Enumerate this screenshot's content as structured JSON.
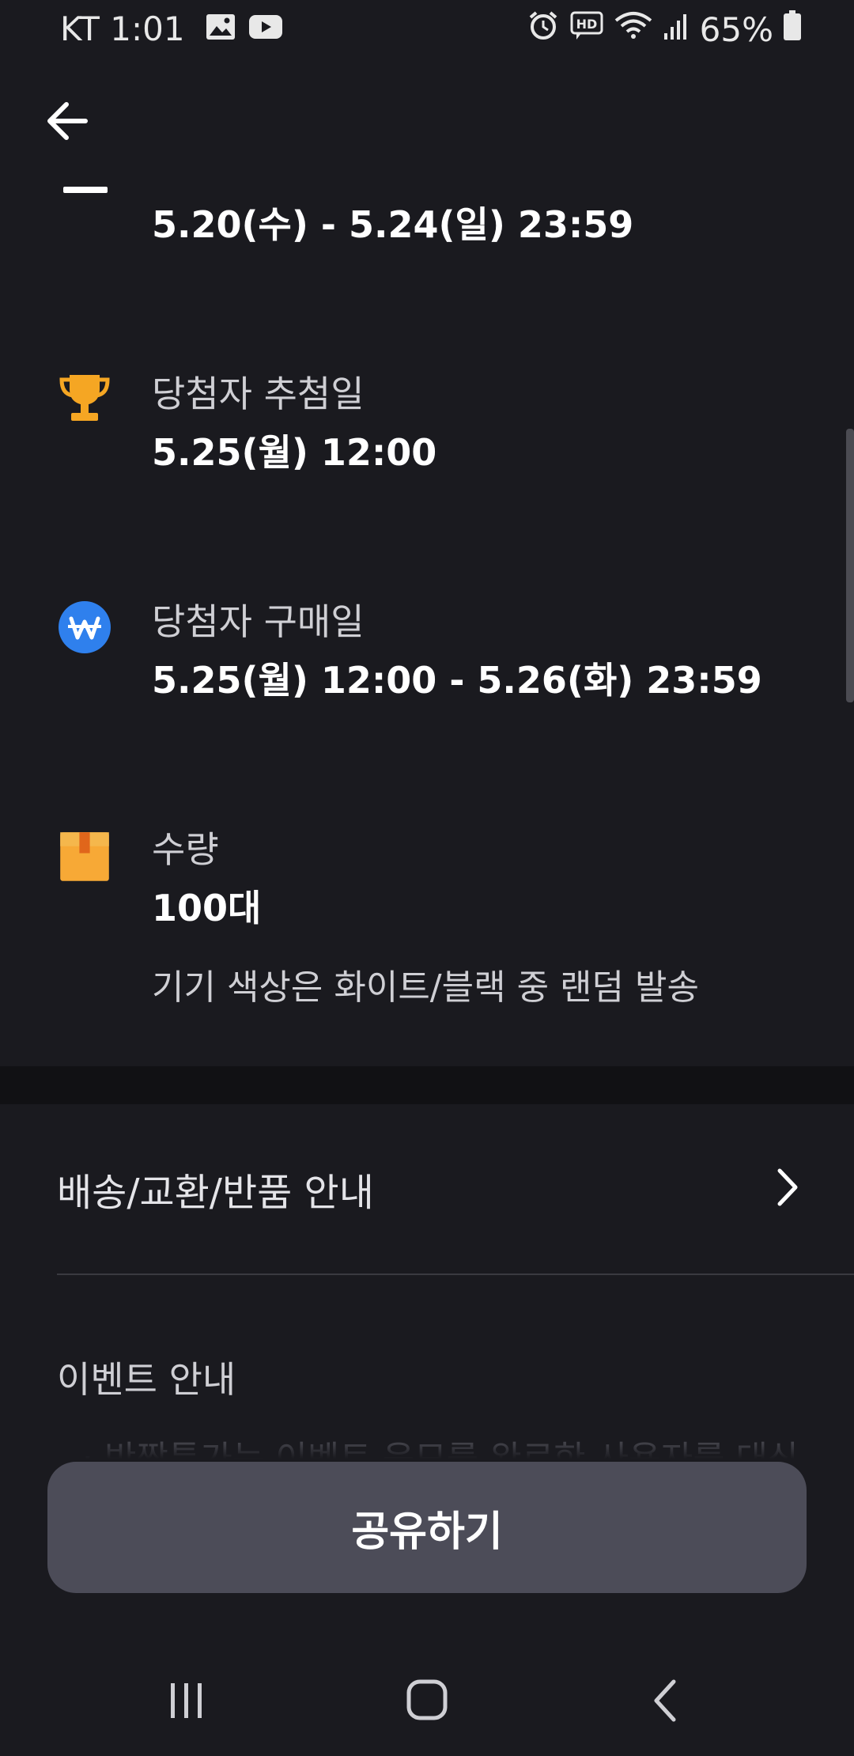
{
  "status_bar": {
    "carrier_time": "KT 1:01",
    "battery": "65%",
    "icons": [
      "image-icon",
      "youtube-icon",
      "alarm-icon",
      "hd-icon",
      "wifi-icon",
      "signal-icon",
      "battery-icon"
    ]
  },
  "header": {
    "back_icon": "back-arrow-icon"
  },
  "info_items": {
    "entry_period": {
      "value": "5.20(수) - 5.24(일) 23:59"
    },
    "draw_date": {
      "icon": "trophy-icon",
      "label": "당첨자 추첨일",
      "value": "5.25(월) 12:00"
    },
    "purchase_date": {
      "icon": "won-icon",
      "label": "당첨자 구매일",
      "value": "5.25(월) 12:00 - 5.26(화) 23:59"
    },
    "quantity": {
      "icon": "box-icon",
      "label": "수량",
      "value": "100대",
      "note": "기기 색상은 화이트/블랙 중 랜덤 발송"
    }
  },
  "shipping": {
    "label": "배송/교환/반품 안내"
  },
  "event": {
    "title": "이벤트 안내",
    "preview": "· 반짝특가는 이벤트 응모를 완료한 사용자를 대상"
  },
  "share_button": {
    "label": "공유하기"
  },
  "nav_bar": {
    "recent": "recent-apps-icon",
    "home": "home-icon",
    "back": "nav-back-icon"
  },
  "colors": {
    "background": "#1a1a1f",
    "button": "#4c4c58",
    "trophy": "#f5a623",
    "won": "#2f80ed",
    "box": "#f7a936"
  }
}
